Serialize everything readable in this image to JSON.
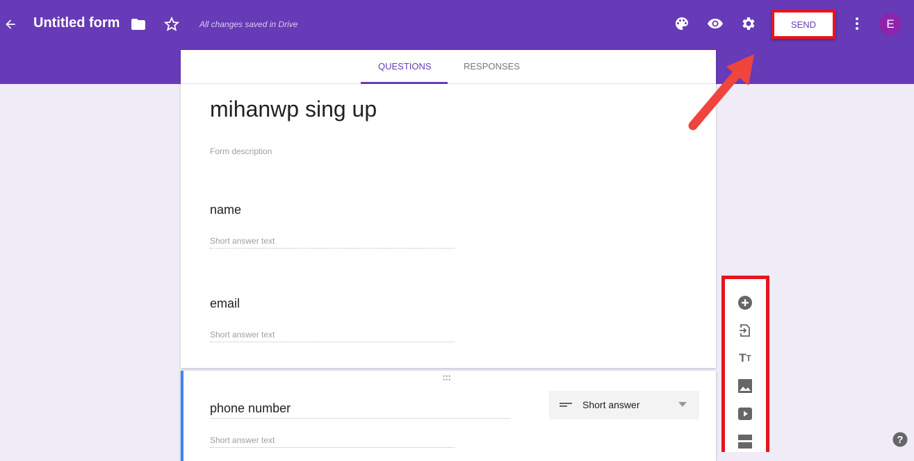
{
  "header": {
    "title": "Untitled form",
    "save_status": "All changes saved in Drive",
    "send_label": "SEND",
    "avatar_initial": "E"
  },
  "tabs": [
    {
      "label": "QUESTIONS",
      "active": true
    },
    {
      "label": "RESPONSES",
      "active": false
    }
  ],
  "form": {
    "title": "mihanwp sing up",
    "description_placeholder": "Form description",
    "questions": [
      {
        "label": "name",
        "answer_placeholder": "Short answer text"
      },
      {
        "label": "email",
        "answer_placeholder": "Short answer text"
      },
      {
        "label": "phone number",
        "answer_placeholder": "Short answer text",
        "type": "Short answer"
      }
    ]
  },
  "toolbar": [
    "add-question-icon",
    "import-questions-icon",
    "add-title-icon",
    "add-image-icon",
    "add-video-icon",
    "add-section-icon"
  ],
  "colors": {
    "brand": "#673ab7",
    "highlight": "#e8141d",
    "active_border": "#4285f4"
  }
}
